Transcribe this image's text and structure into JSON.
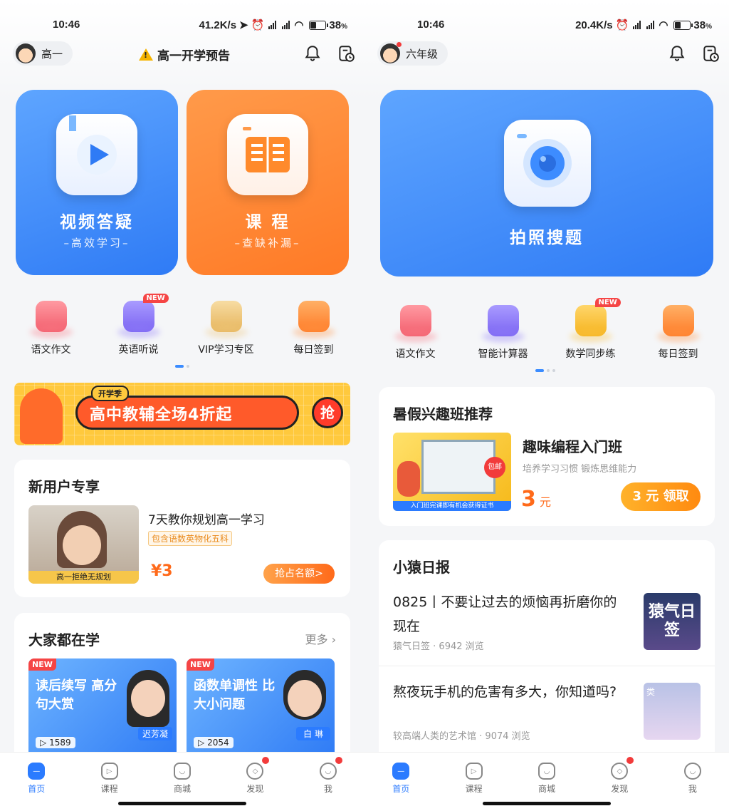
{
  "left": {
    "status": {
      "time": "10:46",
      "speed": "41.2K/s",
      "battery": "38"
    },
    "header": {
      "grade": "高一",
      "title": "高一开学预告"
    },
    "big_cards": [
      {
        "title": "视频答疑",
        "subtitle": "–高效学习–",
        "color": "#3d8cff"
      },
      {
        "title": "课 程",
        "subtitle": "–查缺补漏–",
        "color": "#ff8a2b"
      }
    ],
    "grid": [
      {
        "label": "语文作文",
        "icon": "book-icon",
        "tag": ""
      },
      {
        "label": "英语听说",
        "icon": "headset-icon",
        "tag": "NEW"
      },
      {
        "label": "VIP学习专区",
        "icon": "vip-icon",
        "tag": ""
      },
      {
        "label": "每日签到",
        "icon": "calendar-check-icon",
        "tag": ""
      }
    ],
    "banner": {
      "badge": "开学季",
      "text": "高中教辅全场4折起",
      "action": "抢"
    },
    "new_user": {
      "title": "新用户专享",
      "course_title": "7天教你规划高一学习",
      "tag": "包含语数英物化五科",
      "price": "¥3",
      "thumb_caption": "高一拒绝无规划",
      "button": "抢占名额>"
    },
    "popular": {
      "title": "大家都在学",
      "more": "更多",
      "items": [
        {
          "tag": "NEW",
          "title": "读后续写 高分句大赏",
          "teacher": "迟芳凝",
          "views": "1589"
        },
        {
          "tag": "NEW",
          "title": "函数单调性 比大小问题",
          "teacher": "白 琳",
          "views": "2054"
        }
      ]
    },
    "tabs": [
      {
        "label": "首页",
        "icon": "home-icon",
        "active": true,
        "dot": false
      },
      {
        "label": "课程",
        "icon": "play-icon",
        "active": false,
        "dot": false
      },
      {
        "label": "商城",
        "icon": "shop-icon",
        "active": false,
        "dot": false
      },
      {
        "label": "发现",
        "icon": "compass-icon",
        "active": false,
        "dot": true
      },
      {
        "label": "我",
        "icon": "profile-icon",
        "active": false,
        "dot": true
      }
    ]
  },
  "right": {
    "status": {
      "time": "10:46",
      "speed": "20.4K/s",
      "battery": "38"
    },
    "header": {
      "grade": "六年级"
    },
    "big_card": {
      "title": "拍照搜题",
      "color": "#3d8cff"
    },
    "grid": [
      {
        "label": "语文作文",
        "icon": "book-icon",
        "tag": ""
      },
      {
        "label": "智能计算器",
        "icon": "calculator-icon",
        "tag": ""
      },
      {
        "label": "数学同步练",
        "icon": "exercise-icon",
        "tag": "NEW"
      },
      {
        "label": "每日签到",
        "icon": "calendar-check-icon",
        "tag": ""
      }
    ],
    "summer": {
      "title": "暑假兴趣班推荐",
      "course": "趣味编程入门班",
      "desc": "培养学习习惯 锻炼思维能力",
      "price": "3",
      "unit": "元",
      "button": "3 元 领取",
      "badge": "包邮",
      "strip": "入门班完课即有机会获得证书"
    },
    "daily": {
      "title": "小猿日报",
      "items": [
        {
          "title": "0825丨不要让过去的烦恼再折磨你的现在",
          "source": "猿气日签",
          "views": "6942 浏览",
          "thumb_text": "猿气日签"
        },
        {
          "title": "熬夜玩手机的危害有多大，你知道吗?",
          "source": "较高端人类的艺术馆",
          "views": "9074 浏览",
          "thumb_text": "类"
        }
      ]
    },
    "tabs": [
      {
        "label": "首页",
        "icon": "home-icon",
        "active": true,
        "dot": false
      },
      {
        "label": "课程",
        "icon": "play-icon",
        "active": false,
        "dot": false
      },
      {
        "label": "商城",
        "icon": "shop-icon",
        "active": false,
        "dot": false
      },
      {
        "label": "发现",
        "icon": "compass-icon",
        "active": false,
        "dot": true
      },
      {
        "label": "我",
        "icon": "profile-icon",
        "active": false,
        "dot": true
      }
    ]
  }
}
